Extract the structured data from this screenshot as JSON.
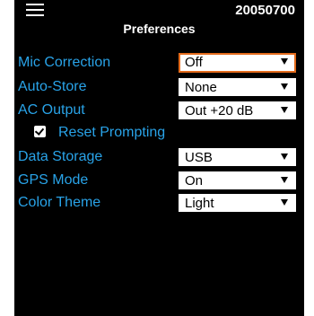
{
  "header": {
    "device_id": "20050700",
    "title": "Preferences"
  },
  "settings": [
    {
      "label": "Mic Correction",
      "value": "Off",
      "focused": true
    },
    {
      "label": "Auto-Store",
      "value": "None"
    },
    {
      "label": "AC Output",
      "value": "Out +20 dB"
    },
    {
      "label": "Data Storage",
      "value": "USB"
    },
    {
      "label": "GPS Mode",
      "value": "On"
    },
    {
      "label": "Color Theme",
      "value": "Light"
    }
  ],
  "reset_prompting": {
    "label": "Reset Prompting",
    "checked": true
  },
  "colors": {
    "label": "#29a3e8",
    "focus_border": "#e36b1c",
    "background": "#000000"
  }
}
